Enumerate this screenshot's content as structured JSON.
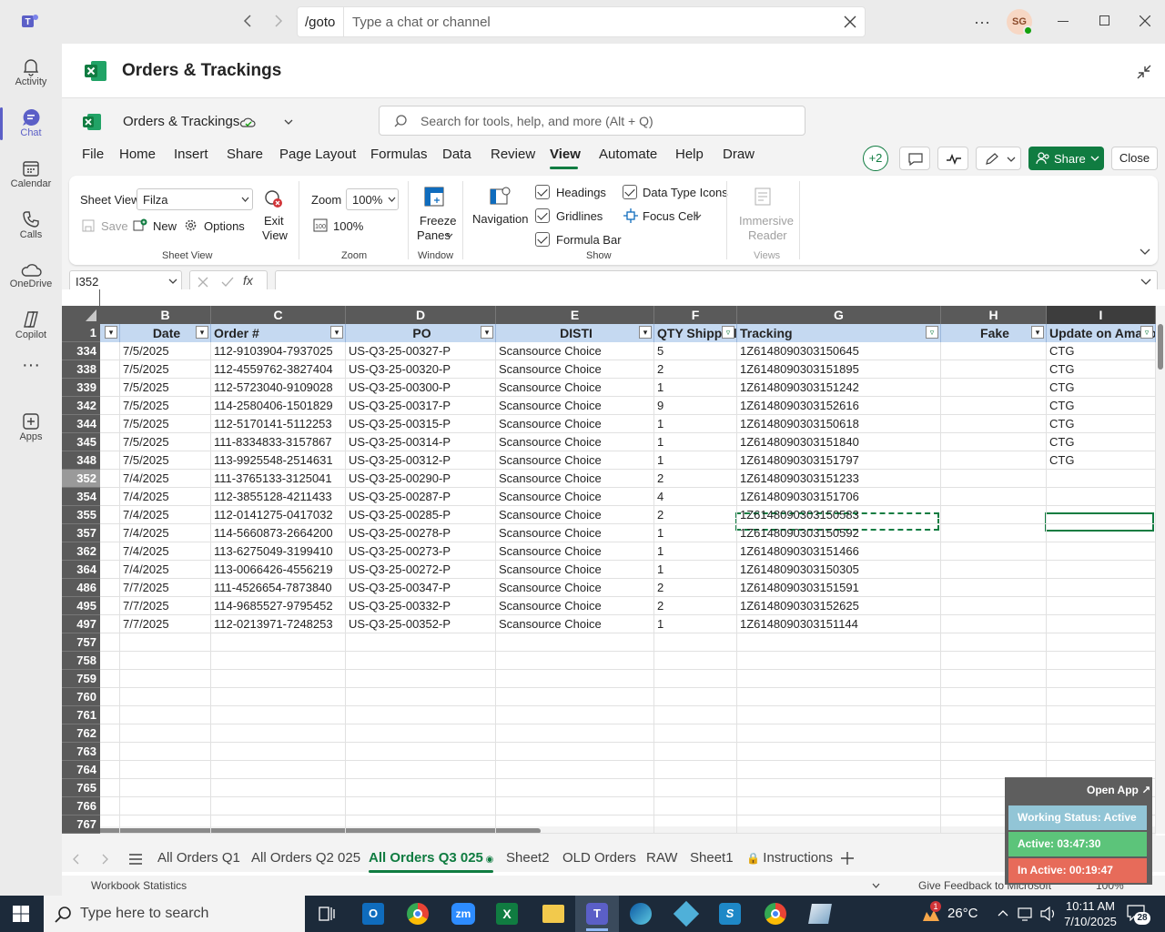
{
  "teams": {
    "goto_label": "/goto",
    "search_placeholder": "Type a chat or channel",
    "avatar_initials": "SG",
    "rail": [
      {
        "label": "Activity",
        "icon": "bell-icon"
      },
      {
        "label": "Chat",
        "icon": "chat-icon"
      },
      {
        "label": "Calendar",
        "icon": "calendar-icon"
      },
      {
        "label": "Calls",
        "icon": "phone-icon"
      },
      {
        "label": "OneDrive",
        "icon": "cloud-icon"
      },
      {
        "label": "Copilot",
        "icon": "copilot-icon"
      },
      {
        "label": "",
        "icon": "more-icon"
      },
      {
        "label": "Apps",
        "icon": "apps-icon"
      }
    ]
  },
  "app": {
    "title": "Orders & Trackings"
  },
  "excel": {
    "file_name": "Orders & Trackings",
    "search_placeholder": "Search for tools, help, and more (Alt + Q)",
    "menu": [
      "File",
      "Home",
      "Insert",
      "Share",
      "Page Layout",
      "Formulas",
      "Data",
      "Review",
      "View",
      "Automate",
      "Help",
      "Draw"
    ],
    "active_menu": "View",
    "collab_count": "+2",
    "share_label": "Share",
    "close_label": "Close",
    "ribbon": {
      "sheet_view_label": "Sheet View",
      "sheet_view_value": "Filza",
      "save": "Save",
      "new": "New",
      "options": "Options",
      "exit_view_1": "Exit",
      "exit_view_2": "View",
      "group_sheet_view": "Sheet View",
      "zoom_label": "Zoom",
      "zoom_value": "100%",
      "zoom_100": "100%",
      "group_zoom": "Zoom",
      "freeze_1": "Freeze",
      "freeze_2": "Panes",
      "group_window": "Window",
      "navigation": "Navigation",
      "headings": "Headings",
      "gridlines": "Gridlines",
      "formula_bar": "Formula Bar",
      "data_type_icons": "Data Type Icons",
      "focus_cell": "Focus Cell",
      "group_show": "Show",
      "immersive_1": "Immersive",
      "immersive_2": "Reader",
      "group_views": "Views"
    },
    "name_box": "I352",
    "columns": [
      "B",
      "C",
      "D",
      "E",
      "F",
      "G",
      "H",
      "I"
    ],
    "headers": [
      "Date",
      "Order #",
      "PO",
      "DISTI",
      "QTY Shipped",
      "Tracking",
      "Fake",
      "Update on Amazon"
    ],
    "rows": [
      {
        "n": "334",
        "c": [
          "7/5/2025",
          "112-9103904-7937025",
          "US-Q3-25-00327-P",
          "Scansource Choice",
          "5",
          "1Z6148090303150645",
          "",
          "CTG"
        ]
      },
      {
        "n": "338",
        "c": [
          "7/5/2025",
          "112-4559762-3827404",
          "US-Q3-25-00320-P",
          "Scansource Choice",
          "2",
          "1Z6148090303151895",
          "",
          "CTG"
        ]
      },
      {
        "n": "339",
        "c": [
          "7/5/2025",
          "112-5723040-9109028",
          "US-Q3-25-00300-P",
          "Scansource Choice",
          "1",
          "1Z6148090303151242",
          "",
          "CTG"
        ]
      },
      {
        "n": "342",
        "c": [
          "7/5/2025",
          "114-2580406-1501829",
          "US-Q3-25-00317-P",
          "Scansource Choice",
          "9",
          "1Z6148090303152616",
          "",
          "CTG"
        ]
      },
      {
        "n": "344",
        "c": [
          "7/5/2025",
          "112-5170141-5112253",
          "US-Q3-25-00315-P",
          "Scansource Choice",
          "1",
          "1Z6148090303150618",
          "",
          "CTG"
        ]
      },
      {
        "n": "345",
        "c": [
          "7/5/2025",
          "111-8334833-3157867",
          "US-Q3-25-00314-P",
          "Scansource Choice",
          "1",
          "1Z6148090303151840",
          "",
          "CTG"
        ]
      },
      {
        "n": "348",
        "c": [
          "7/5/2025",
          "113-9925548-2514631",
          "US-Q3-25-00312-P",
          "Scansource Choice",
          "1",
          "1Z6148090303151797",
          "",
          "CTG"
        ]
      },
      {
        "n": "352",
        "c": [
          "7/4/2025",
          "111-3765133-3125041",
          "US-Q3-25-00290-P",
          "Scansource Choice",
          "2",
          "1Z6148090303151233",
          "",
          ""
        ]
      },
      {
        "n": "354",
        "c": [
          "7/4/2025",
          "112-3855128-4211433",
          "US-Q3-25-00287-P",
          "Scansource Choice",
          "4",
          "1Z6148090303151706",
          "",
          ""
        ]
      },
      {
        "n": "355",
        "c": [
          "7/4/2025",
          "112-0141275-0417032",
          "US-Q3-25-00285-P",
          "Scansource Choice",
          "2",
          "1Z6148090303150583",
          "",
          ""
        ]
      },
      {
        "n": "357",
        "c": [
          "7/4/2025",
          "114-5660873-2664200",
          "US-Q3-25-00278-P",
          "Scansource Choice",
          "1",
          "1Z6148090303150592",
          "",
          ""
        ]
      },
      {
        "n": "362",
        "c": [
          "7/4/2025",
          "113-6275049-3199410",
          "US-Q3-25-00273-P",
          "Scansource Choice",
          "1",
          "1Z6148090303151466",
          "",
          ""
        ]
      },
      {
        "n": "364",
        "c": [
          "7/4/2025",
          "113-0066426-4556219",
          "US-Q3-25-00272-P",
          "Scansource Choice",
          "1",
          "1Z6148090303150305",
          "",
          ""
        ]
      },
      {
        "n": "486",
        "c": [
          "7/7/2025",
          "111-4526654-7873840",
          "US-Q3-25-00347-P",
          "Scansource Choice",
          "2",
          "1Z6148090303151591",
          "",
          ""
        ]
      },
      {
        "n": "495",
        "c": [
          "7/7/2025",
          "114-9685527-9795452",
          "US-Q3-25-00332-P",
          "Scansource Choice",
          "2",
          "1Z6148090303152625",
          "",
          ""
        ]
      },
      {
        "n": "497",
        "c": [
          "7/7/2025",
          "112-0213971-7248253",
          "US-Q3-25-00352-P",
          "Scansource Choice",
          "1",
          "1Z6148090303151144",
          "",
          ""
        ]
      },
      {
        "n": "757",
        "c": [
          "",
          "",
          "",
          "",
          "",
          "",
          "",
          ""
        ]
      },
      {
        "n": "758",
        "c": [
          "",
          "",
          "",
          "",
          "",
          "",
          "",
          ""
        ]
      },
      {
        "n": "759",
        "c": [
          "",
          "",
          "",
          "",
          "",
          "",
          "",
          ""
        ]
      },
      {
        "n": "760",
        "c": [
          "",
          "",
          "",
          "",
          "",
          "",
          "",
          ""
        ]
      },
      {
        "n": "761",
        "c": [
          "",
          "",
          "",
          "",
          "",
          "",
          "",
          ""
        ]
      },
      {
        "n": "762",
        "c": [
          "",
          "",
          "",
          "",
          "",
          "",
          "",
          ""
        ]
      },
      {
        "n": "763",
        "c": [
          "",
          "",
          "",
          "",
          "",
          "",
          "",
          ""
        ]
      },
      {
        "n": "764",
        "c": [
          "",
          "",
          "",
          "",
          "",
          "",
          "",
          ""
        ]
      },
      {
        "n": "765",
        "c": [
          "",
          "",
          "",
          "",
          "",
          "",
          "",
          ""
        ]
      },
      {
        "n": "766",
        "c": [
          "",
          "",
          "",
          "",
          "",
          "",
          "",
          ""
        ]
      },
      {
        "n": "767",
        "c": [
          "",
          "",
          "",
          "",
          "",
          "",
          "",
          ""
        ]
      }
    ],
    "header_row_num": "1",
    "sheets": [
      "All Orders Q1",
      "All Orders Q2 025",
      "All Orders Q3 025",
      "Sheet2",
      "OLD Orders",
      "RAW",
      "Sheet1",
      "Instructions"
    ],
    "active_sheet": "All Orders Q3 025",
    "status_left": "Workbook Statistics",
    "status_feedback": "Give Feedback to Microsoft",
    "status_zoom": "100%"
  },
  "widget": {
    "open_app": "Open App ↗",
    "working_status": "Working Status: Active",
    "active": "Active: 03:47:30",
    "inactive": "In Active: 00:19:47",
    "color_status": "#92c5d6",
    "color_active": "#5cc47a",
    "color_inactive": "#e76b5a"
  },
  "taskbar": {
    "search_placeholder": "Type here to search",
    "weather": "26°C",
    "time": "10:11 AM",
    "date": "7/10/2025",
    "notifications": "28",
    "weather_badge": "1"
  }
}
